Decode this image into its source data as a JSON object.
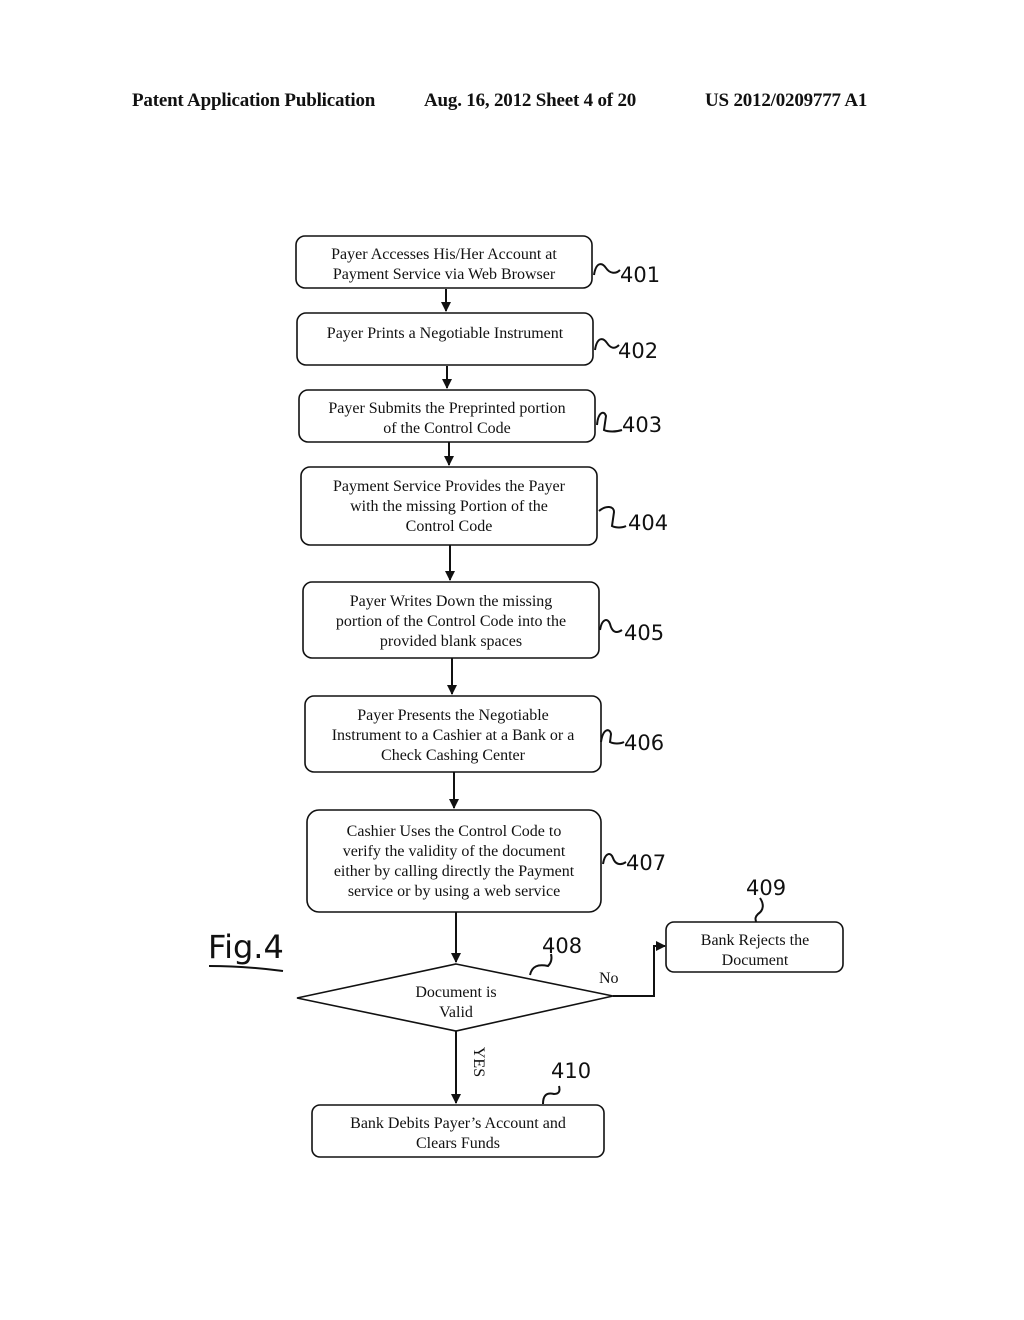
{
  "header": {
    "left": "Patent Application Publication",
    "middle": "Aug. 16, 2012  Sheet 4 of 20",
    "right": "US 2012/0209777 A1"
  },
  "figure_label": "Fig.4",
  "steps": [
    {
      "ref": "401",
      "lines": [
        "Payer Accesses His/Her Account at",
        "Payment Service via Web Browser"
      ]
    },
    {
      "ref": "402",
      "lines": [
        "Payer Prints a Negotiable Instrument"
      ]
    },
    {
      "ref": "403",
      "lines": [
        "Payer Submits the Preprinted portion",
        "of the Control Code"
      ]
    },
    {
      "ref": "404",
      "lines": [
        "Payment Service Provides the Payer",
        "with the missing Portion of the",
        "Control Code"
      ]
    },
    {
      "ref": "405",
      "lines": [
        "Payer Writes Down the missing",
        "portion of the Control Code into the",
        "provided blank spaces"
      ]
    },
    {
      "ref": "406",
      "lines": [
        "Payer Presents the Negotiable",
        "Instrument to a Cashier at a Bank or a",
        "Check Cashing Center"
      ]
    },
    {
      "ref": "407",
      "lines": [
        "Cashier Uses the Control Code to",
        "verify the validity of the document",
        "either by calling directly the Payment",
        "service or by using a web service"
      ]
    }
  ],
  "decision": {
    "ref": "408",
    "lines": [
      "Document is",
      "Valid"
    ],
    "no_label": "No",
    "yes_label": "YES"
  },
  "reject": {
    "ref": "409",
    "lines": [
      "Bank Rejects the",
      "Document"
    ]
  },
  "accept": {
    "ref": "410",
    "lines": [
      "Bank Debits Payer’s Account and",
      "Clears Funds"
    ]
  }
}
